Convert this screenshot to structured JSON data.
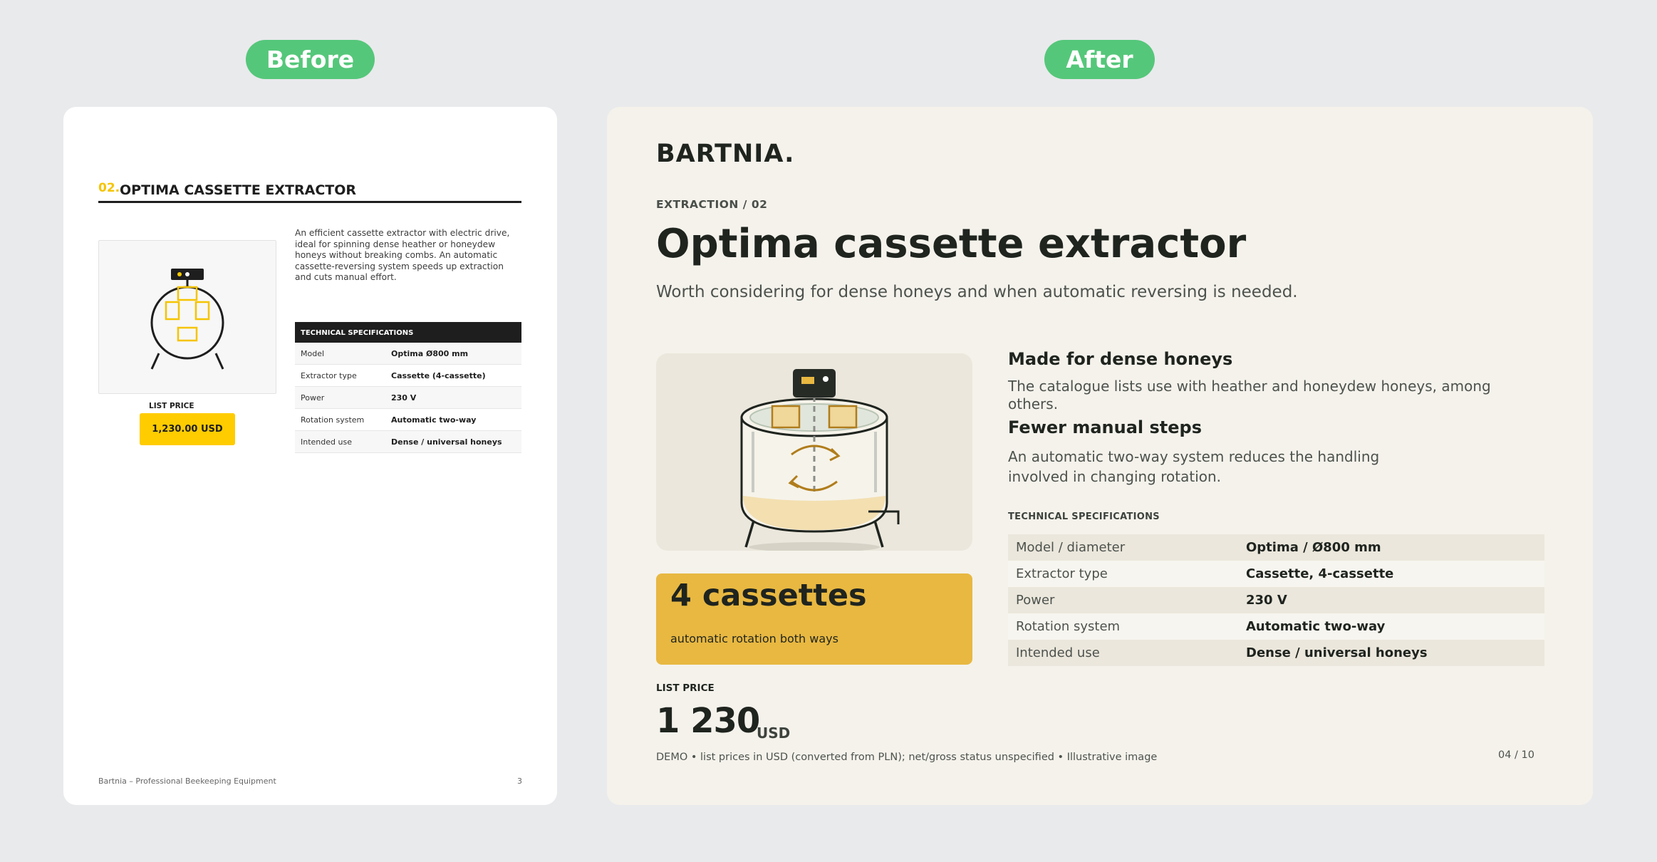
{
  "labels": {
    "before": "Before",
    "after": "After"
  },
  "before_page": {
    "heading_number": "02.",
    "heading_title": "OPTIMA CASSETTE EXTRACTOR",
    "description": "An efficient cassette extractor with electric drive, ideal for spinning dense heather or honeydew honeys without breaking combs. An automatic cassette-reversing system speeds up extraction and cuts manual effort.",
    "price_label": "LIST PRICE",
    "price": "1,230.00 USD",
    "spec_title": "TECHNICAL SPECIFICATIONS",
    "specs": [
      {
        "key": "Model",
        "value": "Optima Ø800 mm"
      },
      {
        "key": "Extractor type",
        "value": "Cassette (4-cassette)"
      },
      {
        "key": "Power",
        "value": "230 V"
      },
      {
        "key": "Rotation system",
        "value": "Automatic two-way"
      },
      {
        "key": "Intended use",
        "value": "Dense / universal honeys"
      }
    ],
    "footer": "Bartnia – Professional Beekeeping Equipment",
    "page_number": "3"
  },
  "after_page": {
    "logo": "BARTNIA.",
    "eyebrow": "EXTRACTION / 02",
    "title": "Optima cassette extractor",
    "subtitle": "Worth considering for dense honeys and when automatic reversing is needed.",
    "callout_big": "4 cassettes",
    "callout_small": "automatic rotation both ways",
    "price_label": "LIST PRICE",
    "price_value": "1 230",
    "price_currency": "USD",
    "feature_1_title": "Made for dense honeys",
    "feature_1_body": "The catalogue lists use with heather and honeydew honeys, among others.",
    "feature_2_title": "Fewer manual steps",
    "feature_2_body": "An automatic two-way system reduces the handling involved in changing rotation.",
    "spec_title": "TECHNICAL SPECIFICATIONS",
    "specs": [
      {
        "key": "Model / diameter",
        "value": "Optima / Ø800 mm"
      },
      {
        "key": "Extractor type",
        "value": "Cassette, 4-cassette"
      },
      {
        "key": "Power",
        "value": "230 V"
      },
      {
        "key": "Rotation system",
        "value": "Automatic two-way"
      },
      {
        "key": "Intended use",
        "value": "Dense / universal honeys"
      }
    ],
    "footer": "DEMO • list prices in USD (converted from PLN); net/gross status unspecified • Illustrative image",
    "page_number": "04 / 10"
  },
  "colors": {
    "pill_green": "#55c77a",
    "before_accent_yellow": "#ffcc00",
    "after_accent_gold": "#e8b841",
    "after_background": "#f4f2eb",
    "dark_text": "#1f241f"
  },
  "icons": [
    "honey-extractor-illustration",
    "honey-extractor-line-icon"
  ]
}
